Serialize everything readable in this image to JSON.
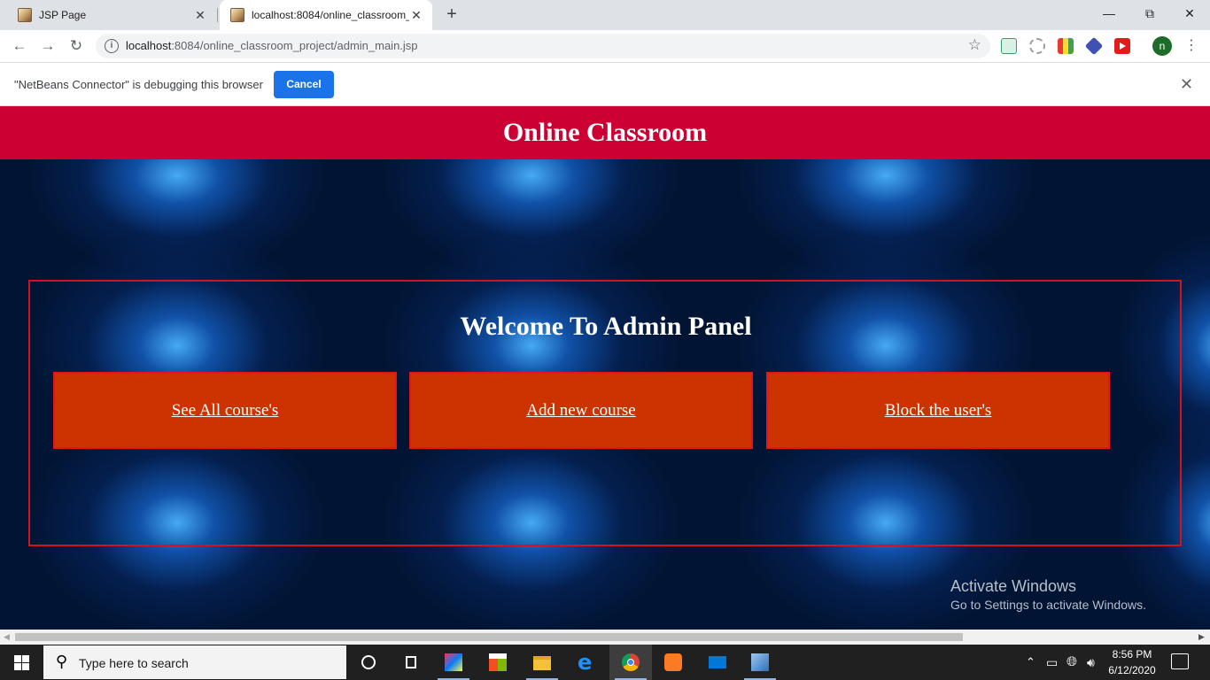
{
  "browser": {
    "tabs": [
      {
        "title": "JSP Page"
      },
      {
        "title": "localhost:8084/online_classroom_"
      }
    ],
    "url": {
      "host": "localhost",
      "rest": ":8084/online_classroom_project/admin_main.jsp"
    },
    "profile_initial": "n",
    "infobar": {
      "message": "\"NetBeans Connector\" is debugging this browser",
      "cancel_label": "Cancel"
    }
  },
  "page": {
    "header_title": "Online Classroom",
    "panel_title": "Welcome To Admin Panel",
    "actions": [
      {
        "label": "See All course's"
      },
      {
        "label": "Add new course"
      },
      {
        "label": "Block the user's"
      }
    ],
    "colors": {
      "header": "#cc0033",
      "button": "#cc3300",
      "border": "#d3121c",
      "background": "#021433"
    }
  },
  "watermark": {
    "line1": "Activate Windows",
    "line2": "Go to Settings to activate Windows."
  },
  "taskbar": {
    "search_placeholder": "Type here to search",
    "time": "8:56 PM",
    "date": "6/12/2020",
    "icons": [
      "task-view",
      "intellij",
      "store",
      "file-explorer",
      "edge",
      "chrome",
      "xampp",
      "mail",
      "virtualbox"
    ]
  }
}
